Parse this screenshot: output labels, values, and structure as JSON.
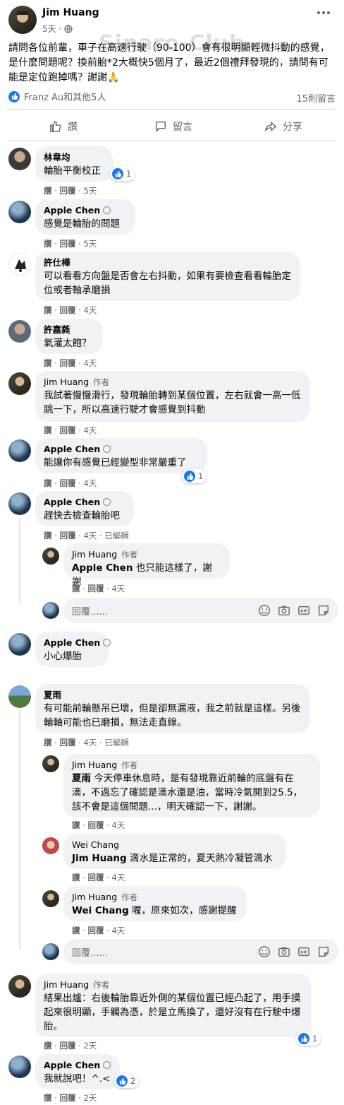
{
  "post": {
    "author": "Jim Huang",
    "time": "5天",
    "privacy_icon": "globe-icon",
    "text": "請問各位前輩，車子在高速行駛（90-100）會有很明顯輕微抖動的感覺，是什麼問題呢？換前胎*2大概快5個月了，最近2個禮拜發現的，請問有可能是定位跑掉嗎？謝謝🙏",
    "watermark": "Sinaro-Club",
    "reactions_text": "Franz Au和其他5人",
    "comment_count": "15則留言",
    "actions": {
      "like": "讚",
      "comment": "留言",
      "share": "分享"
    }
  },
  "labels": {
    "like": "讚",
    "reply": "回覆",
    "edited": "已編輯",
    "author_badge": "作者",
    "reply_placeholder": "回覆......"
  },
  "comments": [
    {
      "name": "林韋均",
      "text": "輪胎平衡校正",
      "time": "5天",
      "reactions": "1"
    },
    {
      "name": "Apple Chen",
      "text": "感覺是輪胎的問題",
      "time": "5天"
    },
    {
      "name": "許仕樺",
      "text": "可以看看方向盤是否會左右抖動，如果有要檢查看看輪胎定位或者軸承磨損",
      "time": "4天"
    },
    {
      "name": "許嘉蕤",
      "text": "氣灌太飽？",
      "time": "4天"
    },
    {
      "name": "Jim Huang",
      "author": true,
      "text": "我試著慢慢滑行，發現輪胎轉到某個位置，左右就會一高一低跳一下，所以高速行駛才會感覺到抖動",
      "time": "4天"
    },
    {
      "name": "Apple Chen",
      "text": "能讓你有感覺已經變型非常嚴重了",
      "time": "4天",
      "reactions": "1"
    },
    {
      "name": "Apple Chen",
      "text": "趕快去檢查輪胎吧",
      "time": "4天",
      "edited": true,
      "replies": [
        {
          "name": "Jim Huang",
          "author": true,
          "mention": "Apple Chen",
          "text": " 也只能這樣了，謝謝",
          "time": "4天"
        }
      ]
    },
    {
      "name": "Apple Chen",
      "text": "小心爆胎",
      "time": ""
    },
    {
      "name": "夏雨",
      "text": "有可能前輪懸吊已壞，但是卻無漏液，我之前就是這樣。另後輪軸可能也已磨損，無法走直線。",
      "time": "4天",
      "edited": true,
      "replies": [
        {
          "name": "Jim Huang",
          "author": true,
          "mention": "夏雨",
          "text": " 今天停車休息時，是有發現靠近前輪的底盤有在滴，不過忘了確認是滴水還是油，當時冷氣開到25.5，該不會是這個問題...，明天確認一下，謝謝。",
          "time": "4天"
        },
        {
          "name": "Wei Chang",
          "mention": "Jim Huang",
          "text": " 滴水是正常的，夏天熱冷凝管滴水",
          "time": "4天"
        },
        {
          "name": "Jim Huang",
          "author": true,
          "mention": "Wei Chang",
          "text": " 喔，原來如次，感謝提醒",
          "time": "4天"
        }
      ]
    },
    {
      "name": "Jim Huang",
      "author": true,
      "text": "結果出爐：右後輪胎靠近外側的某個位置已經凸起了，用手摸起來很明顯，手觸為憑，於是立馬換了，還好沒有在行駛中爆胎。",
      "time": "2天",
      "reactions": "1"
    },
    {
      "name": "Apple Chen",
      "text": "我就說吧！^.<",
      "time": "2天",
      "reactions": "2"
    }
  ],
  "colors": {
    "accent": "#1877f2",
    "bubble": "#f0f2f5",
    "meta": "#65676b",
    "text": "#050505"
  }
}
